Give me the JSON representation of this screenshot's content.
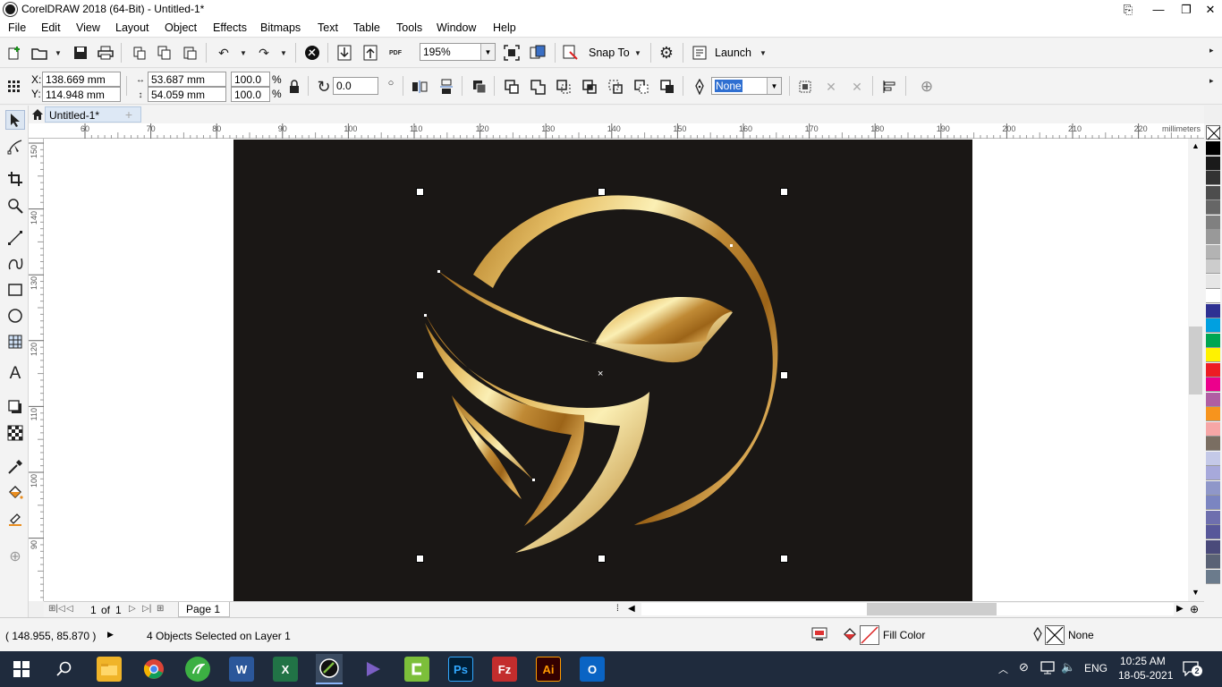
{
  "app": {
    "title": "CorelDRAW 2018 (64-Bit) - Untitled-1*"
  },
  "menu": [
    "File",
    "Edit",
    "View",
    "Layout",
    "Object",
    "Effects",
    "Bitmaps",
    "Text",
    "Table",
    "Tools",
    "Window",
    "Help"
  ],
  "toolbar": {
    "zoom": "195%",
    "snap_to": "Snap To",
    "launch": "Launch"
  },
  "propbar": {
    "x_label": "X:",
    "x_value": "138.669 mm",
    "y_label": "Y:",
    "y_value": "114.948 mm",
    "w_value": "53.687 mm",
    "h_value": "54.059 mm",
    "scale_w": "100.0",
    "scale_h": "100.0",
    "percent": "%",
    "rotation": "0.0",
    "outline": "None"
  },
  "doc_tab": "Untitled-1*",
  "ruler": {
    "unit": "millimeters",
    "h_ticks": [
      "60",
      "70",
      "80",
      "90",
      "100",
      "110",
      "120",
      "130",
      "140",
      "150",
      "160",
      "170",
      "180",
      "190",
      "200",
      "210",
      "220"
    ],
    "v_ticks": [
      "150",
      "140",
      "130",
      "120",
      "110",
      "100",
      "90"
    ]
  },
  "page_nav": {
    "current": "1",
    "of": "of",
    "total": "1",
    "page_tab": "Page 1"
  },
  "status": {
    "coords": "( 148.955, 85.870 )",
    "selection": "4 Objects Selected on Layer 1",
    "fill": "Fill Color",
    "outline": "None"
  },
  "taskbar": {
    "lang": "ENG",
    "time": "10:25 AM",
    "date": "18-05-2021",
    "notif": "2"
  },
  "palette_colors": [
    "#000000",
    "#1a1a1a",
    "#333333",
    "#4d4d4d",
    "#666666",
    "#808080",
    "#999999",
    "#b3b3b3",
    "#cccccc",
    "#e6e6e6",
    "#ffffff",
    "#2e3192",
    "#00a0e0",
    "#00a651",
    "#fff200",
    "#ed1c24",
    "#ec008c",
    "#b05ea3",
    "#f7941d",
    "#f6a6a6",
    "#7a6e62",
    "#c4c9e8",
    "#a7a9db",
    "#8f97c9",
    "#7b85c1",
    "#6e6fae",
    "#58589a",
    "#4a4a7a",
    "#5a6275",
    "#6b7b8c"
  ],
  "colors": {
    "artboard": "#1a1715",
    "gold_light": "#fbefb4",
    "gold_dark": "#a66c1c"
  }
}
